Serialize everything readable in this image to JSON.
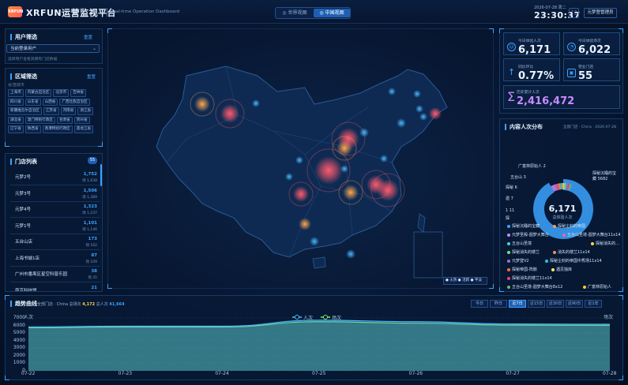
{
  "header": {
    "logo_text": "XRFUN",
    "title": "XRFUN运营监视平台",
    "subtitle": "Real-time Operation Dashboard",
    "view_world": "世界视图",
    "view_china": "中国视图",
    "date": "2026-07-28 周二",
    "time": "23:30:37",
    "fullscreen_icon": "fullscreen-icon",
    "user_label": "元梦登管理员"
  },
  "user_filter": {
    "title": "用户筛选",
    "reset": "重置",
    "select_value": "当前登录用户",
    "hint": "选择用户查看其拥有门店数据"
  },
  "region_filter": {
    "title": "区域筛选",
    "reset": "重置",
    "label": "省/直辖市",
    "chips": [
      "上海市",
      "内蒙古自治区",
      "北京市",
      "吉林省",
      "四川省",
      "山东省",
      "山西省",
      "广西壮族自治区",
      "新疆维吾尔自治区",
      "江苏省",
      "河南省",
      "浙江省",
      "湖北省",
      "澳门特别行政区",
      "甘肃省",
      "贵州省",
      "辽宁省",
      "陕西省",
      "香港特别行政区",
      "黑龙江省"
    ]
  },
  "store_list": {
    "title": "门店列表",
    "count": "55",
    "rows": [
      {
        "name": "元梦2号",
        "value": "1,752",
        "sub": "场 1,638"
      },
      {
        "name": "元梦3号",
        "value": "1,506",
        "sub": "场 1,389"
      },
      {
        "name": "元梦4号",
        "value": "1,323",
        "sub": "场 1,237"
      },
      {
        "name": "元梦1号",
        "value": "1,101",
        "sub": "场 1,146"
      },
      {
        "name": "五台山店",
        "value": "173",
        "sub": "场 162"
      },
      {
        "name": "上海书城1店",
        "value": "87",
        "sub": "场 109"
      },
      {
        "name": "广州市番禺区星空科普乐园",
        "value": "38",
        "sub": "场 35"
      },
      {
        "name": "南京科技馆",
        "value": "21",
        "sub": "场 19"
      }
    ]
  },
  "stats": {
    "today_users_label": "今日体验人次",
    "today_users": "6,171",
    "today_sessions_label": "今日体验场次",
    "today_sessions": "6,022",
    "rate_label": "同比环比",
    "rate": "0.77%",
    "stores_label": "营业门店",
    "stores": "55",
    "total_label": "历史累计人次",
    "total": "2,416,472"
  },
  "content": {
    "title": "内容人次分布",
    "meta": "全部门店 · China · 2026-07-28",
    "center_value": "6,171",
    "center_label": "总体验人次",
    "ring_labels": [
      "广富林原始人 2",
      "五台山 3",
      "探秘沉睡的宝藏 5682",
      "探秘 6",
      "遗 7",
      "1 11",
      "探"
    ],
    "legend": [
      {
        "label": "探秘沉睡的宝藏",
        "color": "#3ba3ff"
      },
      {
        "label": "探秘尘封的帝国",
        "color": "#ff9f40"
      },
      {
        "label": "元梦圣殿-圆梦大舞台",
        "color": "#c58cff"
      },
      {
        "label": "五台山圣境-圆梦大舞台11x14",
        "color": "#ff5fa2"
      },
      {
        "label": "五台山圣境",
        "color": "#4dd0e1"
      },
      {
        "label": "探秘消失的…",
        "color": "#ffd34d"
      },
      {
        "label": "探秘消失的楼兰",
        "color": "#7ee36e"
      },
      {
        "label": "消失的楼兰11x14",
        "color": "#ff8a65"
      },
      {
        "label": "元梦登V2",
        "color": "#9575cd"
      },
      {
        "label": "探秘尘封的帝国中秀场11x14",
        "color": "#26c6da"
      },
      {
        "label": "探秘帝国-阵骸",
        "color": "#ff7043"
      },
      {
        "label": "遇见独库",
        "color": "#ffee58"
      },
      {
        "label": "探秘消失的楼兰11x14",
        "color": "#ec407a"
      },
      {
        "label": "五台山圣境-圆梦大舞台8x12",
        "color": "#66bb6a"
      },
      {
        "label": "广富林原始人",
        "color": "#ffca28"
      }
    ],
    "ring": [
      {
        "value": 5682,
        "color": "#3ba3ff"
      },
      {
        "value": 180,
        "color": "#c58cff"
      },
      {
        "value": 120,
        "color": "#ff5fa2"
      },
      {
        "value": 60,
        "color": "#ff9f40"
      },
      {
        "value": 45,
        "color": "#4dd0e1"
      },
      {
        "value": 30,
        "color": "#ffd34d"
      },
      {
        "value": 20,
        "color": "#7ee36e"
      },
      {
        "value": 14,
        "color": "#9575cd"
      },
      {
        "value": 11,
        "color": "#ec407a"
      },
      {
        "value": 9,
        "color": "#66bb6a"
      }
    ]
  },
  "map": {
    "legend": "● 火热 ● 活跃 ● 平淡",
    "hot_color": "#ff5a6e",
    "warm_color": "#ffa84d",
    "cool_color": "#49b8ff"
  },
  "trend": {
    "title": "趋势曲线",
    "meta_scope": "全部门店 · China",
    "meta_sessions_label": "总场次",
    "meta_sessions": "4,172",
    "meta_users_label": "总人次",
    "meta_users": "41,664",
    "ranges": [
      "今日",
      "昨日",
      "近7日",
      "近15日",
      "近30日",
      "近90日",
      "近1年"
    ],
    "active_range": 2
  },
  "chart_data": {
    "type": "area",
    "title": "",
    "xlabel": "",
    "ylabel": "人次",
    "y2label": "场次",
    "x": [
      "07-22",
      "07-23",
      "07-24",
      "07-25",
      "07-26",
      "07-27",
      "07-28"
    ],
    "ylim": [
      0,
      7000
    ],
    "yticks": [
      0,
      1000,
      2000,
      3000,
      4000,
      5000,
      6000,
      7000
    ],
    "series": [
      {
        "name": "人次",
        "color": "#49b8ff",
        "values": [
          5800,
          5900,
          5900,
          6700,
          6500,
          6200,
          6171
        ]
      },
      {
        "name": "场次",
        "color": "#7ee36e",
        "values": [
          5700,
          5800,
          5800,
          6500,
          6300,
          6050,
          6022
        ]
      }
    ],
    "legend": "top-center",
    "grid": true
  }
}
